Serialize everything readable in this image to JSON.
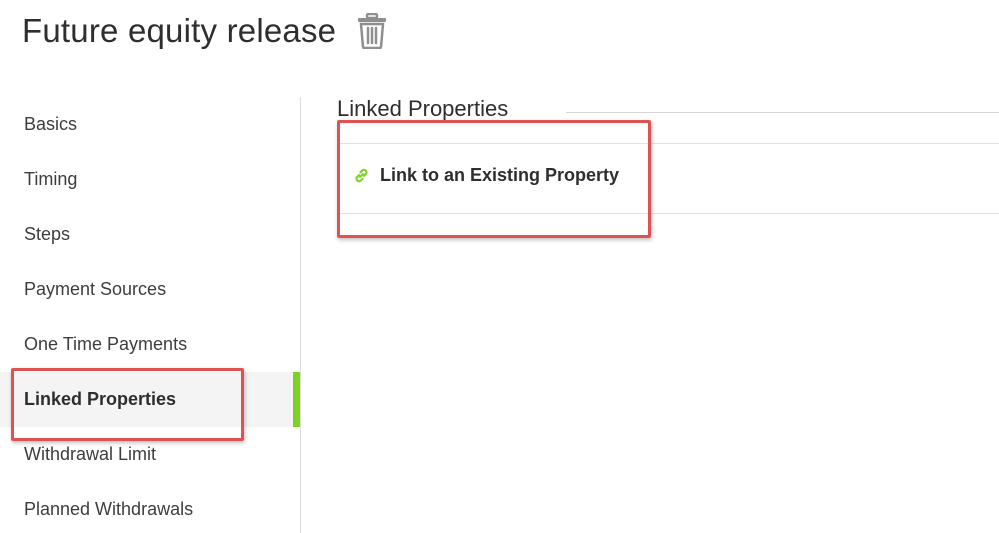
{
  "page": {
    "title": "Future equity release",
    "delete_icon": "trash-icon"
  },
  "sidebar": {
    "items": [
      {
        "label": "Basics"
      },
      {
        "label": "Timing"
      },
      {
        "label": "Steps"
      },
      {
        "label": "Payment Sources"
      },
      {
        "label": "One Time Payments"
      },
      {
        "label": "Linked Properties",
        "active": true
      },
      {
        "label": "Withdrawal Limit"
      },
      {
        "label": "Planned Withdrawals"
      }
    ],
    "active_indicator_color": "#7ed321"
  },
  "main": {
    "section_title": "Linked Properties",
    "link_action": {
      "label": "Link to an Existing Property",
      "icon": "link-icon",
      "icon_color": "#7ed321"
    }
  },
  "annotations": {
    "highlight_color": "#e05252"
  }
}
